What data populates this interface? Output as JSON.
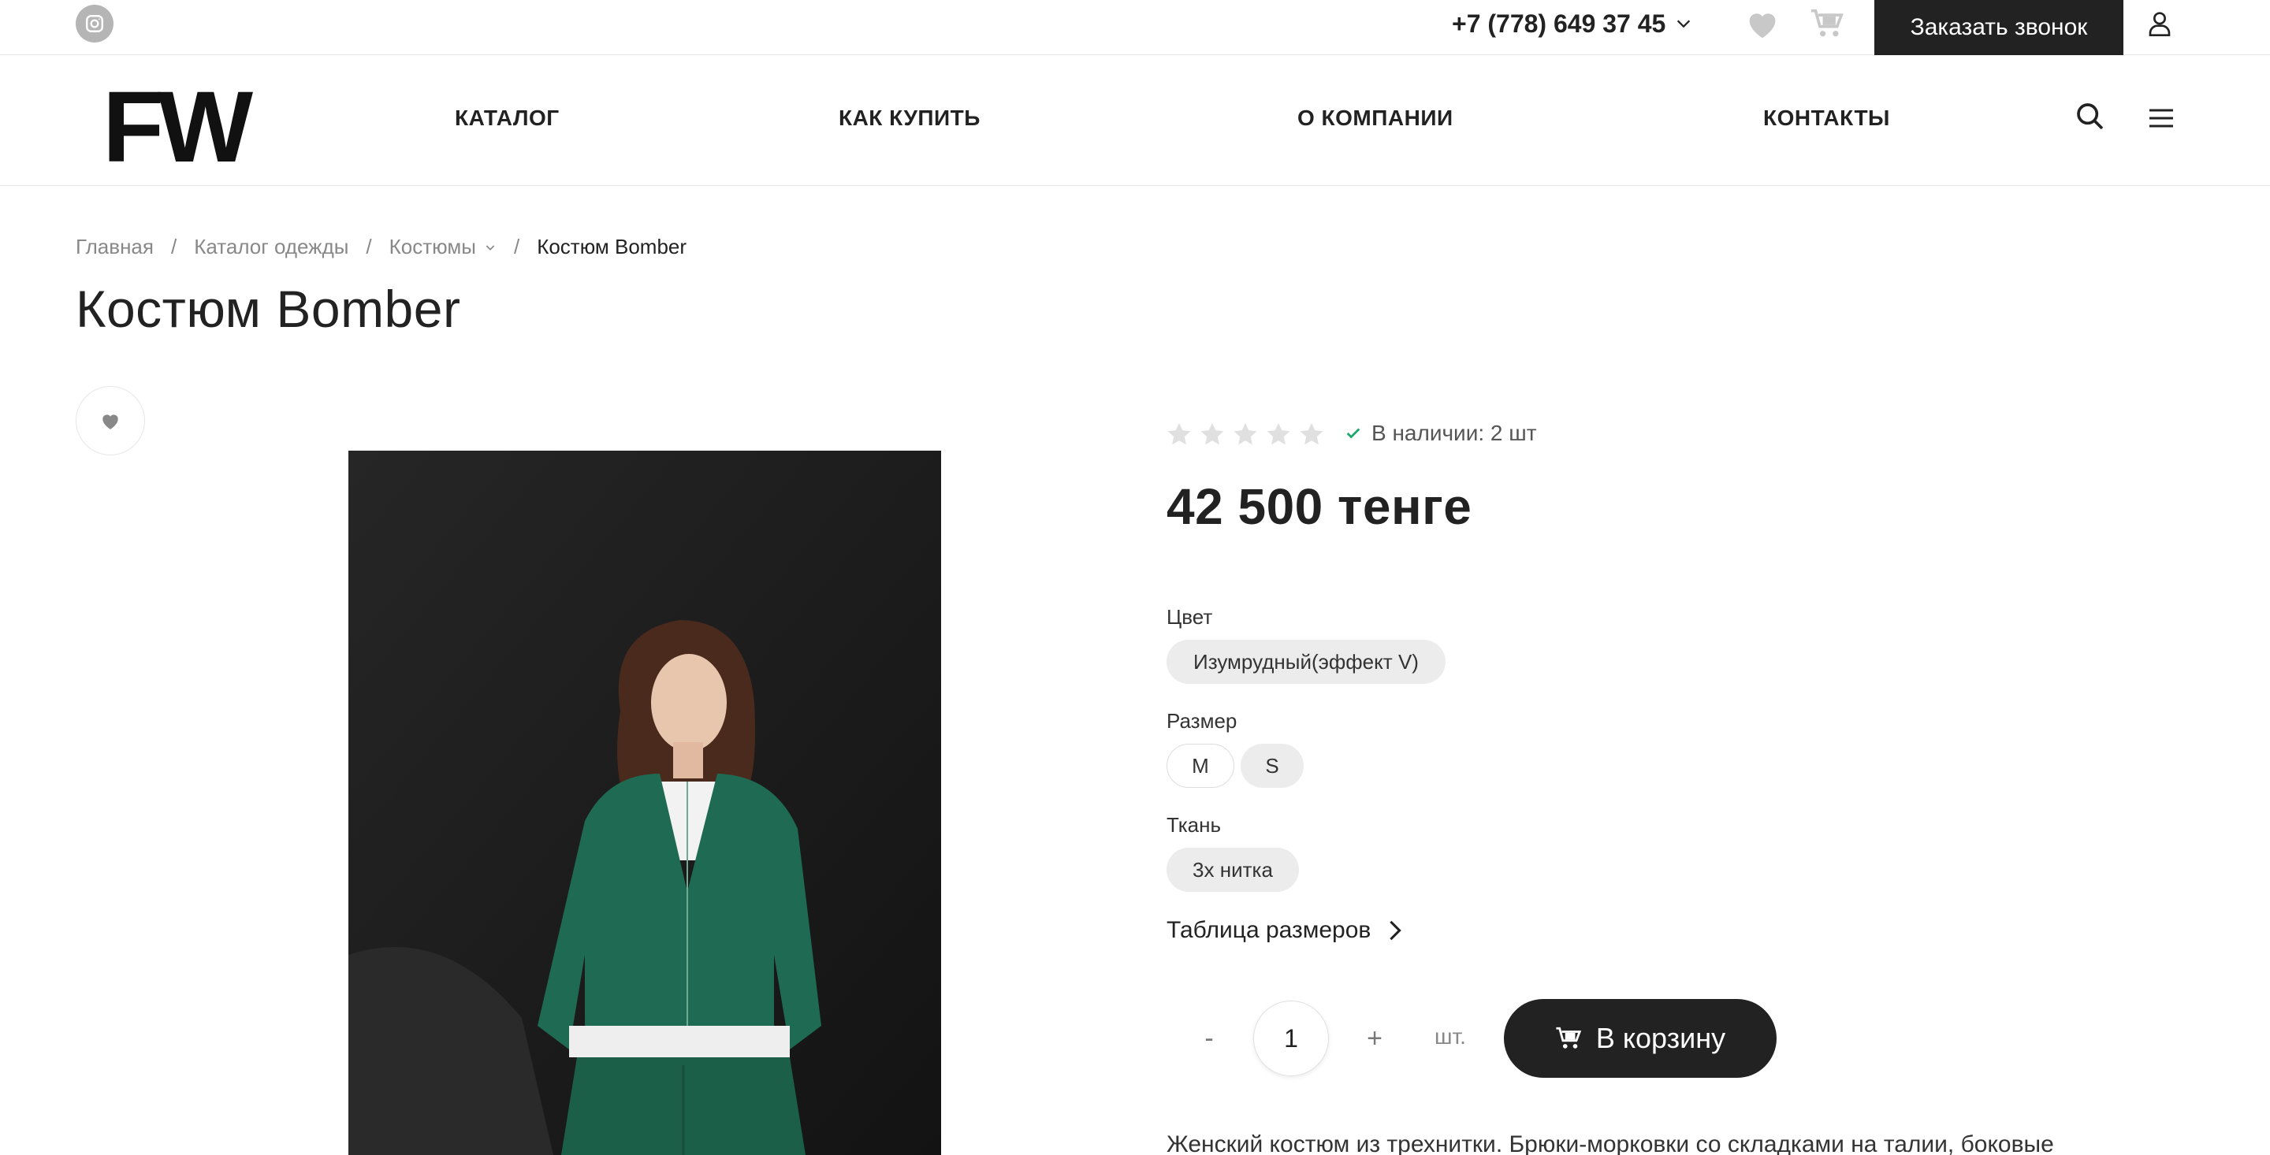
{
  "topbar": {
    "phone": "+7 (778) 649 37 45",
    "callback_label": "Заказать звонок"
  },
  "header": {
    "logo": "FW",
    "nav": [
      "КАТАЛОГ",
      "КАК КУПИТЬ",
      "О КОМПАНИИ",
      "КОНТАКТЫ"
    ]
  },
  "breadcrumb": {
    "items": [
      "Главная",
      "Каталог одежды",
      "Костюмы",
      "Костюм Bomber"
    ],
    "separator": "/"
  },
  "product": {
    "title": "Костюм Bomber",
    "rating": {
      "value": 0,
      "max": 5
    },
    "stock": "В наличии: 2 шт",
    "price": "42 500 тенге",
    "color_label": "Цвет",
    "colors": [
      "Изумрудный(эффект V)"
    ],
    "size_label": "Размер",
    "sizes": [
      "M",
      "S"
    ],
    "fabric_label": "Ткань",
    "fabrics": [
      "3х нитка"
    ],
    "size_table_label": "Таблица размеров",
    "quantity": {
      "minus": "-",
      "value": "1",
      "plus": "+",
      "unit": "шт."
    },
    "add_to_cart": "В корзину",
    "description": "Женский костюм из трехнитки. Брюки-морковки со складками на талии, боковые"
  },
  "colors": {
    "dark": "#222222",
    "chip_bg": "#ececec",
    "check": "#1aa86a",
    "muted": "#888888",
    "star_empty": "#e0e0e0"
  }
}
